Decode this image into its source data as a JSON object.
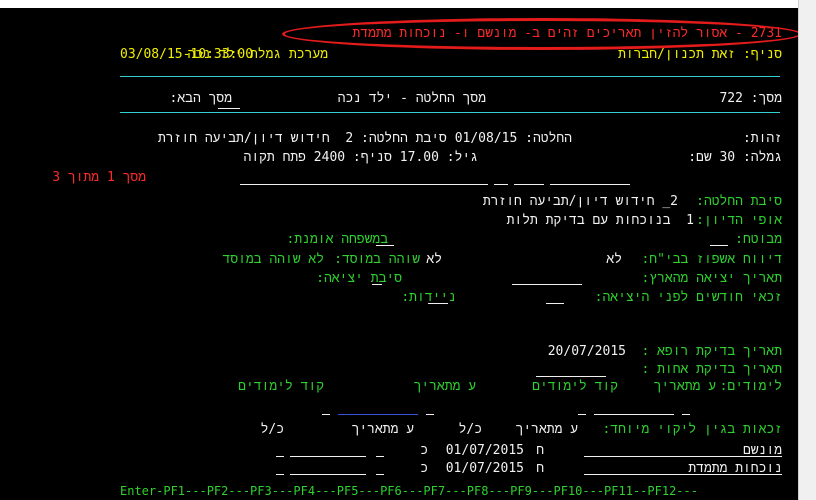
{
  "header": {
    "error_message": "2731 - אסור להזין תאריכים זהים ב- מונשם ו- נוכחות מתמדת",
    "datetime": "03/08/15-10:33:00",
    "branch": "סניף: זאת תכנון/חברות",
    "subtitle": "מערכת גמלת ילד נכה"
  },
  "screen_bar": {
    "screen": "מסך: 722",
    "title": "מסך החלטה - ילד נכה",
    "next_screen": "מסך הבא:"
  },
  "decision_info": {
    "id_label": "זהות:",
    "decision": "החלטה: 01/08/15 סיבת החלטה: 2  חידוש דיון/תביעה חוזרת",
    "benefit": "גמלה: 30 שם:",
    "age_branch": "גיל: 17.00 סניף: 2400 פתח תקוה",
    "page_indicator": "מסך 1 מתוך 3"
  },
  "form": {
    "reason_label": "סיבת החלטה:",
    "reason_value": "2_ חידוש דיון/תביעה חוזרת",
    "discussion_label": "אופי הדיון:",
    "discussion_value": "1  בנוכחות עם בדיקת תלות",
    "insured_label": "מבוטח:",
    "foster_label": "במשפחה אומנת:",
    "hosp_label": "דיווח אשפוז בבי\"ח:",
    "hosp_value": "לא",
    "institution_label": "שוהה במוסד:",
    "institution_value": "לא",
    "institution_desc": "לא שוהה במוסד",
    "exit_date_label": "תאריך יציאה מהארץ:",
    "exit_reason_label": "סיבת יציאה:",
    "months_label": "זכאי חודשים לפני היציאה:",
    "mobility_label": "ניידות:",
    "doctor_date_label": "תאריך בדיקת רופא :",
    "doctor_date_value": "20/07/2015",
    "nurse_date_label": "תאריך בדיקת אחות :",
    "studies_label": "לימודים:",
    "from_date_1": "ע מתאריך",
    "study_code_1": "קוד לימודים",
    "from_date_2": "ע מתאריך",
    "study_code_2": "קוד לימודים",
    "special_label": "זכאות בגין ליקוי מיוחד:",
    "col_from": "ע מתאריך",
    "col_yn": "כ/ל",
    "col_from_2": "ע מתאריך",
    "col_yn_2": "כ/ל",
    "row1_label": "מונשם",
    "row1_flag": "ח",
    "row1_date": "01/07/2015",
    "row1_yn": "כ",
    "row2_label": "נוכחות מתמדת",
    "row2_flag": "ח",
    "row2_date": "01/07/2015",
    "row2_yn": "כ"
  },
  "function_keys": "Enter-PF1---PF2---PF3---PF4---PF5---PF6---PF7---PF8---PF9---PF10---PF11--PF12---"
}
